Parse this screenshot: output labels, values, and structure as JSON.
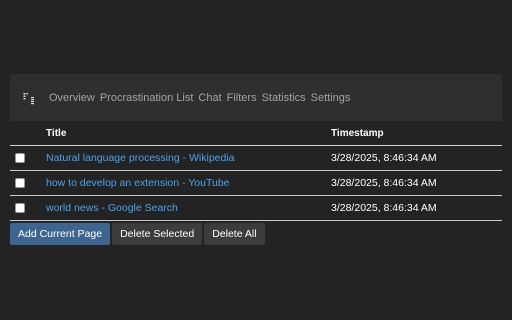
{
  "nav": {
    "logo_icon": "extension-logo-icon",
    "links": [
      {
        "label": "Overview"
      },
      {
        "label": "Procrastination List"
      },
      {
        "label": "Chat"
      },
      {
        "label": "Filters"
      },
      {
        "label": "Statistics"
      },
      {
        "label": "Settings"
      }
    ]
  },
  "table": {
    "headers": {
      "title": "Title",
      "timestamp": "Timestamp"
    },
    "rows": [
      {
        "title": "Natural language processing - Wikipedia",
        "timestamp": "3/28/2025, 8:46:34 AM",
        "checked": false
      },
      {
        "title": "how to develop an extension - YouTube",
        "timestamp": "3/28/2025, 8:46:34 AM",
        "checked": false
      },
      {
        "title": "world news - Google Search",
        "timestamp": "3/28/2025, 8:46:34 AM",
        "checked": false
      }
    ]
  },
  "actions": {
    "add_label": "Add Current Page",
    "delete_selected_label": "Delete Selected",
    "delete_all_label": "Delete All"
  },
  "colors": {
    "background": "#232323",
    "nav_background": "#2f2f2f",
    "link": "#4aa3f0",
    "primary_button": "#3d6590",
    "secondary_button": "#3c3c3c"
  }
}
